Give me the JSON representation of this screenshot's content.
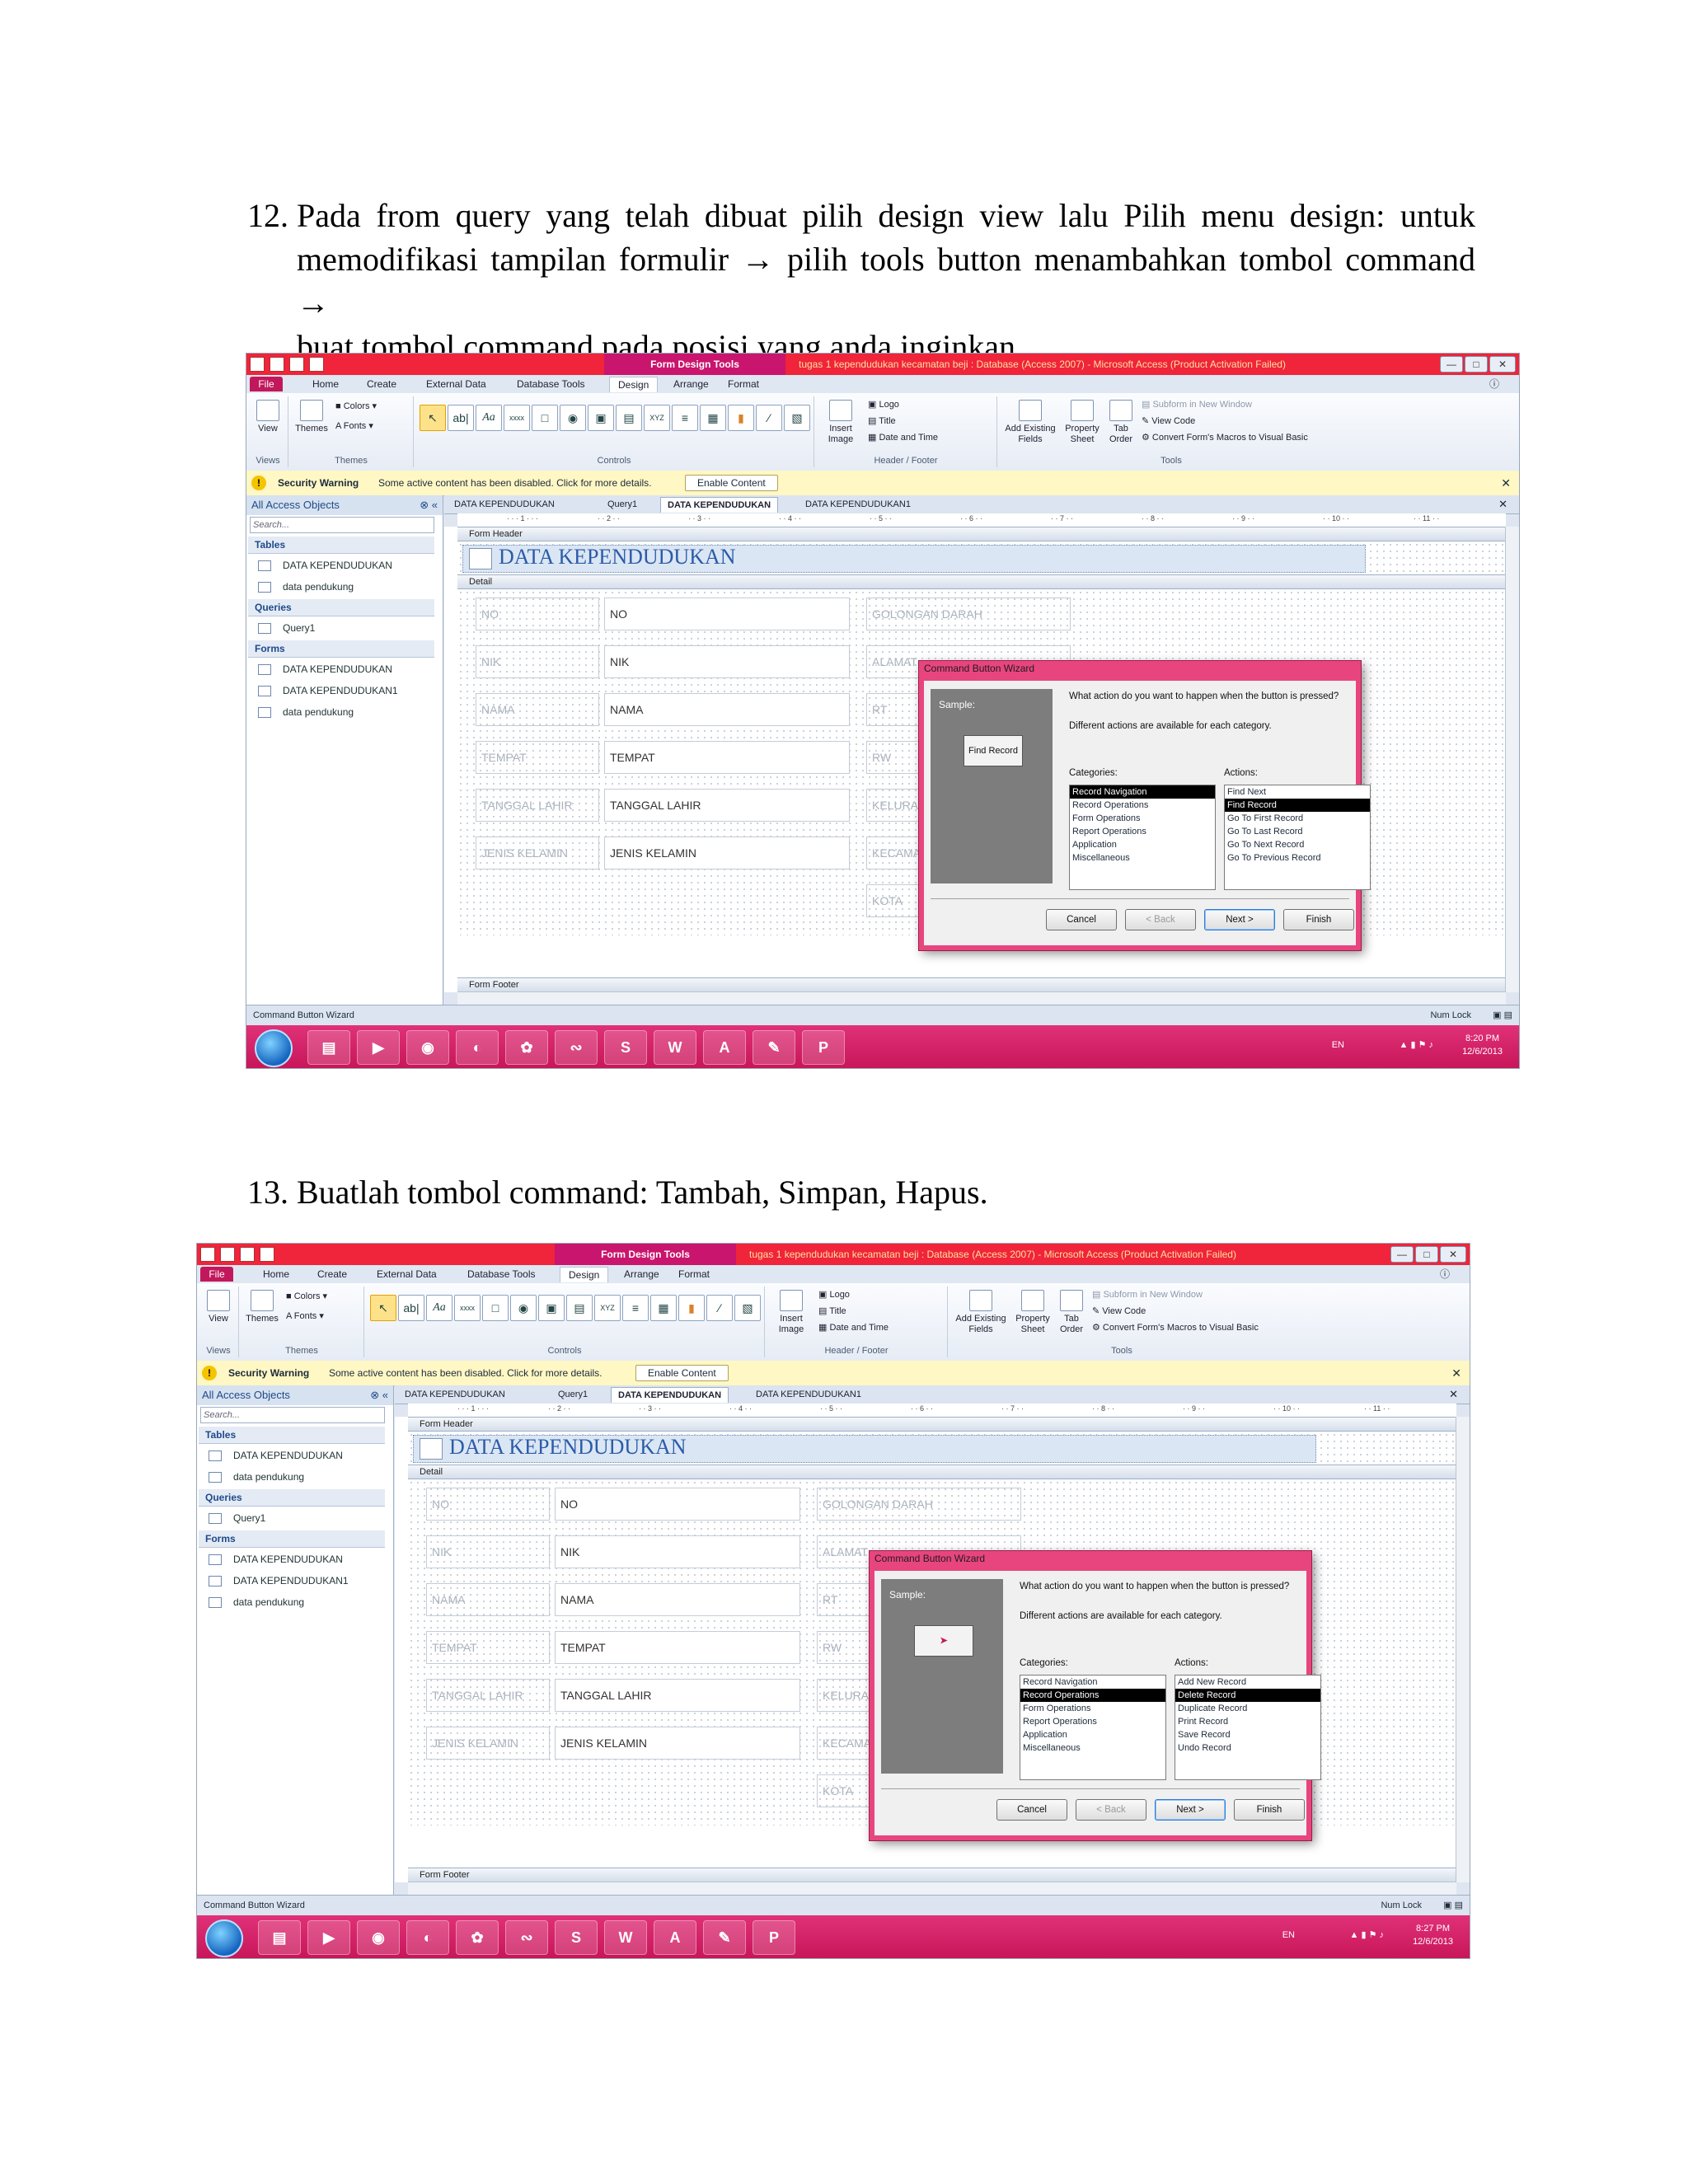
{
  "steps": [
    {
      "number": "12.",
      "lines": [
        "Pada from query yang telah dibuat pilih design view lalu Pilih menu design: untuk",
        "memodifikasi tampilan formulir → pilih tools button menambahkan tombol command →",
        "buat tombol command pada posisi yang anda inginkan."
      ]
    },
    {
      "number": "13.",
      "lines": [
        "Buatlah tombol command: Tambah, Simpan, Hapus."
      ]
    }
  ],
  "screenshots": [
    {
      "context_tab": "Form Design Tools",
      "window_title": "tugas 1 kependudukan kecamatan beji : Database (Access 2007) - Microsoft Access (Product Activation Failed)",
      "ribbon_tabs": [
        "File",
        "Home",
        "Create",
        "External Data",
        "Database Tools",
        "Design",
        "Arrange",
        "Format"
      ],
      "groups": {
        "views": "Views",
        "themes": "Themes",
        "controls": "Controls",
        "header_footer": "Header / Footer",
        "tools": "Tools"
      },
      "ribbon": {
        "view": "View",
        "themes": "Themes",
        "colors": "Colors",
        "fonts": "Fonts",
        "insert_image": "Insert Image",
        "logo": "Logo",
        "title": "Title",
        "date_time": "Date and Time",
        "add_existing_fields": "Add Existing Fields",
        "property_sheet": "Property Sheet",
        "tab_order": "Tab Order",
        "subform": "Subform in New Window",
        "view_code": "View Code",
        "convert_macros": "Convert Form's Macros to Visual Basic"
      },
      "security": {
        "label": "Security Warning",
        "message": "Some active content has been disabled. Click for more details.",
        "button": "Enable Content"
      },
      "nav": {
        "header": "All Access Objects",
        "search_placeholder": "Search...",
        "sections": [
          {
            "title": "Tables",
            "items": [
              "DATA KEPENDUDUKAN",
              "data pendukung"
            ]
          },
          {
            "title": "Queries",
            "items": [
              "Query1"
            ]
          },
          {
            "title": "Forms",
            "items": [
              "DATA KEPENDUDUKAN",
              "DATA KEPENDUDUKAN1",
              "data pendukung"
            ]
          }
        ]
      },
      "doc_tabs": [
        "DATA KEPENDUDUKAN",
        "Query1",
        "DATA KEPENDUDUKAN",
        "DATA KEPENDUDUKAN1"
      ],
      "bands": {
        "header": "Form Header",
        "detail": "Detail",
        "footer": "Form Footer"
      },
      "form_title": "DATA KEPENDUDUKAN",
      "fields": [
        {
          "label": "NO",
          "text": "NO"
        },
        {
          "label": "NIK",
          "text": "NIK"
        },
        {
          "label": "NAMA",
          "text": "NAMA"
        },
        {
          "label": "TEMPAT",
          "text": "TEMPAT"
        },
        {
          "label": "TANGGAL LAHIR",
          "text": "TANGGAL LAHIR"
        },
        {
          "label": "JENIS KELAMIN",
          "text": "JENIS KELAMIN"
        }
      ],
      "right_labels": [
        "GOLONGAN DARAH",
        "ALAMAT",
        "RT",
        "RW",
        "KELURAHAN",
        "KECAMATAN",
        "KOTA"
      ],
      "wizard": {
        "title": "Command Button Wizard",
        "sample_label": "Sample:",
        "sample_button": "Find Record",
        "question": "What action do you want to happen when the button is pressed?",
        "hint": "Different actions are available for each category.",
        "categories_label": "Categories:",
        "actions_label": "Actions:",
        "categories": [
          "Record Navigation",
          "Record Operations",
          "Form Operations",
          "Report Operations",
          "Application",
          "Miscellaneous"
        ],
        "selected_category": 0,
        "actions": [
          "Find Next",
          "Find Record",
          "Go To First Record",
          "Go To Last Record",
          "Go To Next Record",
          "Go To Previous Record"
        ],
        "selected_action": 1,
        "buttons": {
          "cancel": "Cancel",
          "back": "< Back",
          "next": "Next >",
          "finish": "Finish"
        }
      },
      "status_left": "Command Button Wizard",
      "status_right": "Num Lock",
      "taskbar": {
        "lang": "EN",
        "time": "8:20 PM",
        "date": "12/6/2013"
      }
    },
    {
      "context_tab": "Form Design Tools",
      "window_title": "tugas 1 kependudukan kecamatan beji : Database (Access 2007) - Microsoft Access (Product Activation Failed)",
      "ribbon_tabs": [
        "File",
        "Home",
        "Create",
        "External Data",
        "Database Tools",
        "Design",
        "Arrange",
        "Format"
      ],
      "groups": {
        "views": "Views",
        "themes": "Themes",
        "controls": "Controls",
        "header_footer": "Header / Footer",
        "tools": "Tools"
      },
      "ribbon": {
        "view": "View",
        "themes": "Themes",
        "colors": "Colors",
        "fonts": "Fonts",
        "insert_image": "Insert Image",
        "logo": "Logo",
        "title": "Title",
        "date_time": "Date and Time",
        "add_existing_fields": "Add Existing Fields",
        "property_sheet": "Property Sheet",
        "tab_order": "Tab Order",
        "subform": "Subform in New Window",
        "view_code": "View Code",
        "convert_macros": "Convert Form's Macros to Visual Basic"
      },
      "security": {
        "label": "Security Warning",
        "message": "Some active content has been disabled. Click for more details.",
        "button": "Enable Content"
      },
      "nav": {
        "header": "All Access Objects",
        "search_placeholder": "Search...",
        "sections": [
          {
            "title": "Tables",
            "items": [
              "DATA KEPENDUDUKAN",
              "data pendukung"
            ]
          },
          {
            "title": "Queries",
            "items": [
              "Query1"
            ]
          },
          {
            "title": "Forms",
            "items": [
              "DATA KEPENDUDUKAN",
              "DATA KEPENDUDUKAN1",
              "data pendukung"
            ]
          }
        ]
      },
      "doc_tabs": [
        "DATA KEPENDUDUKAN",
        "Query1",
        "DATA KEPENDUDUKAN",
        "DATA KEPENDUDUKAN1"
      ],
      "bands": {
        "header": "Form Header",
        "detail": "Detail",
        "footer": "Form Footer"
      },
      "form_title": "DATA KEPENDUDUKAN",
      "fields": [
        {
          "label": "NO",
          "text": "NO"
        },
        {
          "label": "NIK",
          "text": "NIK"
        },
        {
          "label": "NAMA",
          "text": "NAMA"
        },
        {
          "label": "TEMPAT",
          "text": "TEMPAT"
        },
        {
          "label": "TANGGAL LAHIR",
          "text": "TANGGAL LAHIR"
        },
        {
          "label": "JENIS KELAMIN",
          "text": "JENIS KELAMIN"
        }
      ],
      "right_labels": [
        "GOLONGAN DARAH",
        "ALAMAT",
        "RT",
        "RW",
        "KELURAHAN",
        "KECAMATAN",
        "KOTA"
      ],
      "wizard": {
        "title": "Command Button Wizard",
        "sample_label": "Sample:",
        "sample_button": "",
        "question": "What action do you want to happen when the button is pressed?",
        "hint": "Different actions are available for each category.",
        "categories_label": "Categories:",
        "actions_label": "Actions:",
        "categories": [
          "Record Navigation",
          "Record Operations",
          "Form Operations",
          "Report Operations",
          "Application",
          "Miscellaneous"
        ],
        "selected_category": 1,
        "actions": [
          "Add New Record",
          "Delete Record",
          "Duplicate Record",
          "Print Record",
          "Save Record",
          "Undo Record"
        ],
        "selected_action": 1,
        "buttons": {
          "cancel": "Cancel",
          "back": "< Back",
          "next": "Next >",
          "finish": "Finish"
        }
      },
      "status_left": "Command Button Wizard",
      "status_right": "Num Lock",
      "taskbar": {
        "lang": "EN",
        "time": "8:27 PM",
        "date": "12/6/2013"
      }
    }
  ]
}
